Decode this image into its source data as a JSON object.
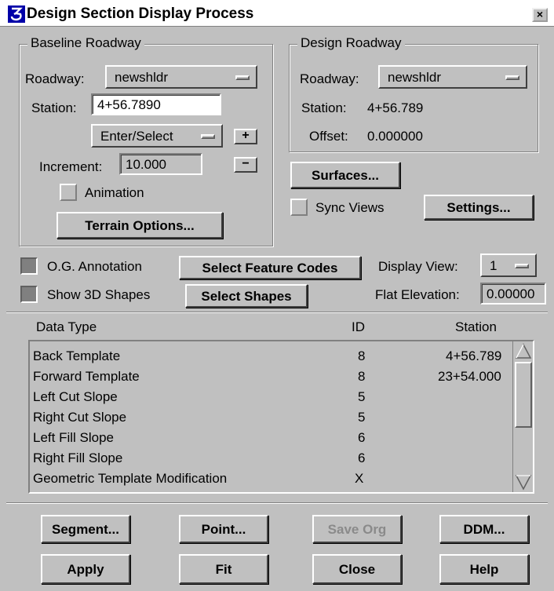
{
  "window": {
    "title": "Design Section Display Process",
    "close_glyph": "×"
  },
  "baseline": {
    "group_title": "Baseline Roadway",
    "roadway_label": "Roadway:",
    "roadway_value": "newshldr",
    "station_label": "Station:",
    "station_value": "4+56.7890",
    "mode_value": "Enter/Select",
    "plus_label": "+",
    "minus_label": "−",
    "increment_label": "Increment:",
    "increment_value": "10.000",
    "animation_label": "Animation",
    "terrain_button": "Terrain Options..."
  },
  "design": {
    "group_title": "Design Roadway",
    "roadway_label": "Roadway:",
    "roadway_value": "newshldr",
    "station_label": "Station:",
    "station_value": "4+56.789",
    "offset_label": "Offset:",
    "offset_value": "0.000000"
  },
  "surfaces_button": "Surfaces...",
  "sync_views_label": "Sync Views",
  "settings_button": "Settings...",
  "og_annotation_label": "O.G. Annotation",
  "select_feature_codes_button": "Select Feature Codes",
  "display_view_label": "Display View:",
  "display_view_value": "1",
  "show_3d_shapes_label": "Show 3D Shapes",
  "select_shapes_button": "Select Shapes",
  "flat_elevation_label": "Flat Elevation:",
  "flat_elevation_value": "0.00000",
  "table": {
    "headers": [
      "Data Type",
      "ID",
      "Station"
    ],
    "rows": [
      {
        "type": "Back Template",
        "id": "8",
        "station": "4+56.789"
      },
      {
        "type": "Forward Template",
        "id": "8",
        "station": "23+54.000"
      },
      {
        "type": "Left Cut Slope",
        "id": "5",
        "station": ""
      },
      {
        "type": "Right Cut Slope",
        "id": "5",
        "station": ""
      },
      {
        "type": "Left Fill Slope",
        "id": "6",
        "station": ""
      },
      {
        "type": "Right Fill Slope",
        "id": "6",
        "station": ""
      },
      {
        "type": "Geometric Template Modification",
        "id": "X",
        "station": ""
      }
    ]
  },
  "buttons": {
    "segment": "Segment...",
    "point": "Point...",
    "save_org": "Save Org",
    "ddm": "DDM...",
    "apply": "Apply",
    "fit": "Fit",
    "close": "Close",
    "help": "Help"
  },
  "checkbox_states": {
    "animation": false,
    "sync_views": false,
    "og_annotation": true,
    "show_3d_shapes": true
  },
  "icons": {
    "app": "application-logo-icon",
    "close": "close-icon",
    "scroll_up": "scroll-up-icon",
    "scroll_down": "scroll-down-icon"
  }
}
